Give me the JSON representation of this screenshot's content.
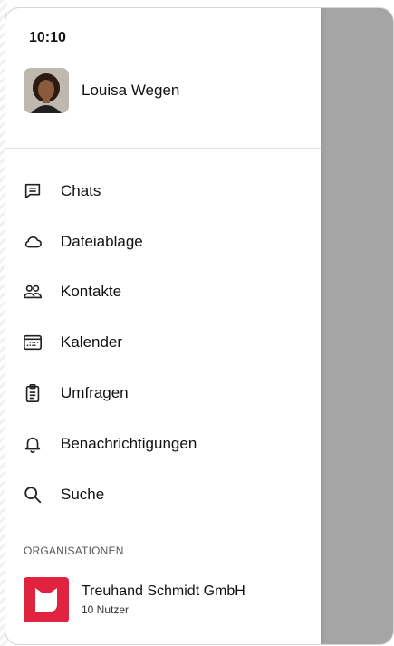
{
  "status_bar": {
    "time": "10:10"
  },
  "profile": {
    "name": "Louisa Wegen",
    "avatar_icon": "user-avatar"
  },
  "menu": {
    "items": [
      {
        "label": "Chats",
        "icon": "chat-bubble-icon"
      },
      {
        "label": "Dateiablage",
        "icon": "cloud-icon"
      },
      {
        "label": "Kontakte",
        "icon": "contacts-icon"
      },
      {
        "label": "Kalender",
        "icon": "calendar-icon"
      },
      {
        "label": "Umfragen",
        "icon": "clipboard-icon"
      },
      {
        "label": "Benachrichtigungen",
        "icon": "bell-icon"
      },
      {
        "label": "Suche",
        "icon": "search-icon"
      }
    ]
  },
  "organisations": {
    "header": "ORGANISATIONEN",
    "items": [
      {
        "name": "Treuhand Schmidt GmbH",
        "members": "10 Nutzer",
        "logo_icon": "cat-logo-icon"
      }
    ]
  },
  "colors": {
    "accent_red": "#e0243f",
    "overlay": "#a5a5a5"
  }
}
